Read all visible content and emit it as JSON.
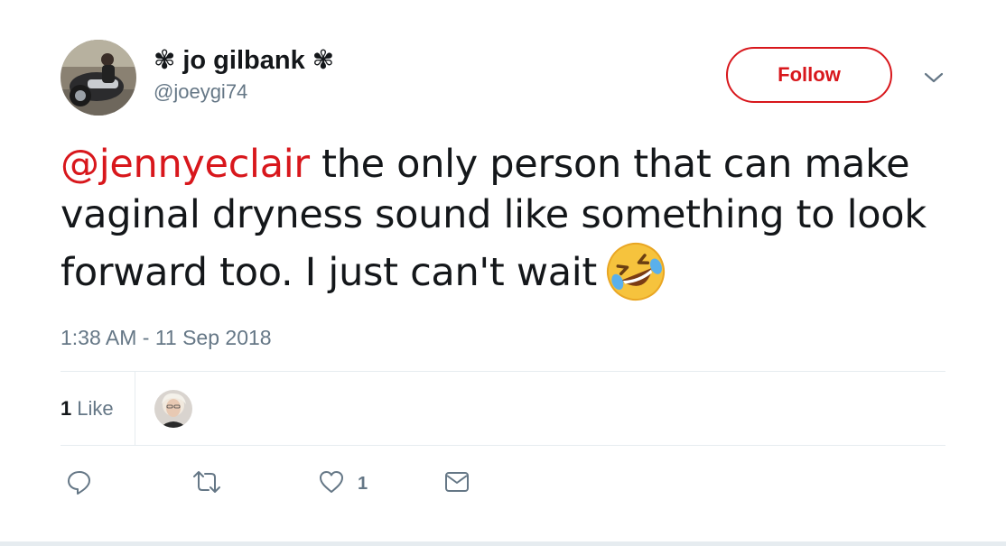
{
  "header": {
    "display_name": "✾ jo gilbank ✾",
    "handle": "@joeygi74",
    "follow_label": "Follow"
  },
  "tweet": {
    "mention": "@jennyeclair",
    "text": " the only person that can make vaginal dryness sound like something to look forward too. I just can't wait",
    "emoji": "rolling-on-the-floor-laughing",
    "timestamp": "1:38 AM - 11 Sep 2018"
  },
  "stats": {
    "likes_count": "1",
    "likes_label": "Like"
  },
  "actions": {
    "reply_icon": "reply-icon",
    "retweet_icon": "retweet-icon",
    "like_icon": "heart-icon",
    "like_count": "1",
    "dm_icon": "envelope-icon"
  },
  "colors": {
    "accent": "#d8171c",
    "secondary_text": "#657786",
    "primary_text": "#14171a",
    "border": "#e6ecf0"
  }
}
